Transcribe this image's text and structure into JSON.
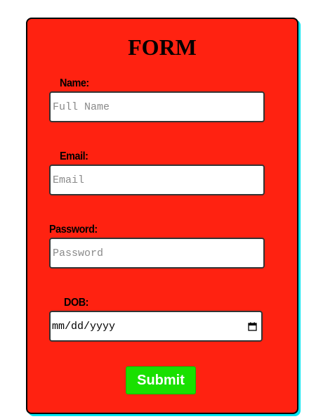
{
  "form": {
    "title": "FORM",
    "fields": {
      "name": {
        "label": "Name:",
        "placeholder": "Full Name",
        "value": ""
      },
      "email": {
        "label": "Email:",
        "placeholder": "Email",
        "value": ""
      },
      "password": {
        "label": "Password:",
        "placeholder": "Password",
        "value": ""
      },
      "dob": {
        "label": "DOB:",
        "placeholder": "mm/dd/yyyy",
        "icon": "calendar-icon"
      }
    },
    "submit_label": "Submit"
  },
  "colors": {
    "card_background": "#ff2211",
    "card_shadow": "#00e5f0",
    "submit_background": "#19e000",
    "submit_text": "#ffffff"
  }
}
